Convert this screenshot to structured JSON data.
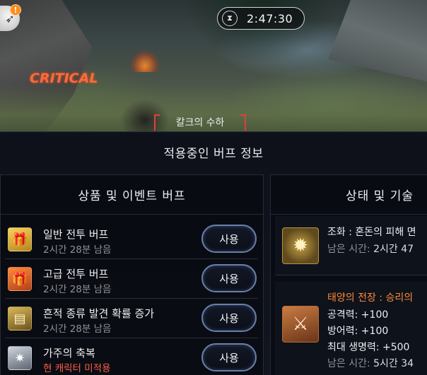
{
  "hud": {
    "timer": "2:47:30",
    "alert_badge": "!",
    "critical_text": "CRITICAL",
    "target_name": "칼크의 수하"
  },
  "panel": {
    "title": "적용중인 버프 정보",
    "product_column": {
      "header": "상품 및 이벤트 버프",
      "items": [
        {
          "name": "일반 전투 버프",
          "sub": "2시간 28분 남음",
          "button": "사용",
          "icon": "gift-gold-icon"
        },
        {
          "name": "고급 전투 버프",
          "sub": "2시간 28분 남음",
          "button": "사용",
          "icon": "gift-orange-icon"
        },
        {
          "name": "흔적 종류 발견 확률 증가",
          "sub": "2시간 28분 남음",
          "button": "사용",
          "icon": "chest-icon"
        },
        {
          "name": "가주의 축복",
          "sub": "현 캐릭터 미적용",
          "button": "사용",
          "icon": "star-blessing-icon"
        }
      ]
    },
    "status_column": {
      "header": "상태 및 기술",
      "items": [
        {
          "line1": "조화 : 혼돈의 피해 면",
          "remain_label": "남은 시간:",
          "remain_value": "2시간 47",
          "icon": "sun-emblem-icon"
        },
        {
          "title": "태양의 전장 : 승리의",
          "stats": [
            "공격력: +100",
            "방어력: +100",
            "최대 생명력: +500"
          ],
          "remain_label": "남은 시간:",
          "remain_value": "5시간 34",
          "icon": "crossed-swords-icon"
        }
      ]
    }
  },
  "colors": {
    "button_border": "#6a7fae",
    "warning_text": "#ff5d4a",
    "title_orange": "#ff8a3a",
    "critical": "#ff6a3a"
  }
}
